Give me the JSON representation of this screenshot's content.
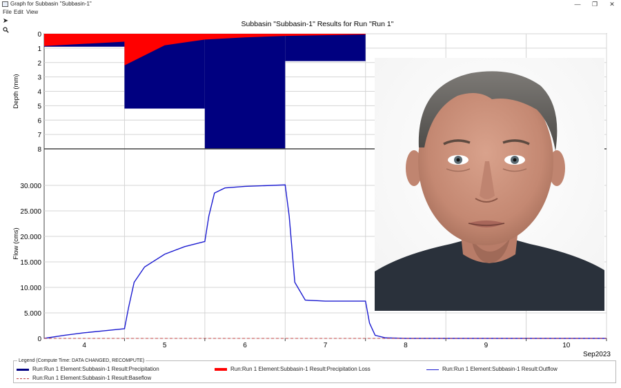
{
  "window": {
    "title": "Graph for Subbasin \"Subbasin-1\"",
    "minimize": "—",
    "restore": "❐",
    "close": "✕"
  },
  "menu": [
    "File",
    "Edit",
    "View"
  ],
  "toolbar": {
    "pointer_icon": "arrow-pointer-icon",
    "zoom_icon": "magnifier-icon"
  },
  "colors": {
    "precipitation": "#000080",
    "precip_loss": "#ff0000",
    "outflow": "#1a1ad0",
    "baseflow": "#c04040",
    "grid": "#d4d4d4"
  },
  "chart_data": [
    {
      "type": "bar",
      "orientation": "inverted",
      "ylabel": "Depth (mm)",
      "yticks": [
        "0",
        "1",
        "2",
        "3",
        "4",
        "5",
        "6",
        "7",
        "8"
      ],
      "ylim": [
        0,
        8
      ],
      "x_days": [
        "4",
        "5",
        "6",
        "7",
        "8",
        "9",
        "10"
      ],
      "precipitation_blocks": [
        {
          "from_day": 3.5,
          "to_day": 4.5,
          "depth": 0.9
        },
        {
          "from_day": 4.5,
          "to_day": 5.5,
          "depth": 5.2
        },
        {
          "from_day": 5.5,
          "to_day": 6.5,
          "depth": 8.0
        },
        {
          "from_day": 6.5,
          "to_day": 7.5,
          "depth": 1.9
        }
      ],
      "precipitation_loss": [
        {
          "day": 3.5,
          "depth": 0.85
        },
        {
          "day": 4.5,
          "depth": 0.55
        },
        {
          "day": 4.5,
          "depth": 2.2
        },
        {
          "day": 5.0,
          "depth": 0.8
        },
        {
          "day": 5.5,
          "depth": 0.4
        },
        {
          "day": 6.0,
          "depth": 0.25
        },
        {
          "day": 6.5,
          "depth": 0.15
        },
        {
          "day": 7.5,
          "depth": 0.05
        }
      ]
    },
    {
      "type": "line",
      "ylabel": "Flow (cms)",
      "yticks": [
        "0",
        "5.000",
        "10.000",
        "15.000",
        "20.000",
        "25.000",
        "30.000"
      ],
      "ylim": [
        0,
        35
      ],
      "xlabel": "Sep2023",
      "x_days": [
        "4",
        "5",
        "6",
        "7",
        "8",
        "9",
        "10"
      ],
      "series": [
        {
          "name": "Run:Run 1 Element:Subbasin-1 Result:Outflow",
          "points": [
            [
              3.5,
              0.0
            ],
            [
              3.75,
              0.6
            ],
            [
              4.0,
              1.1
            ],
            [
              4.25,
              1.5
            ],
            [
              4.5,
              1.9
            ],
            [
              4.55,
              6.0
            ],
            [
              4.62,
              11.0
            ],
            [
              4.75,
              14.0
            ],
            [
              5.0,
              16.5
            ],
            [
              5.25,
              18.0
            ],
            [
              5.5,
              19.0
            ],
            [
              5.55,
              24.0
            ],
            [
              5.62,
              28.5
            ],
            [
              5.75,
              29.5
            ],
            [
              6.0,
              29.8
            ],
            [
              6.5,
              30.1
            ],
            [
              6.55,
              24.0
            ],
            [
              6.62,
              11.0
            ],
            [
              6.75,
              7.5
            ],
            [
              7.0,
              7.3
            ],
            [
              7.5,
              7.3
            ],
            [
              7.55,
              3.0
            ],
            [
              7.62,
              0.6
            ],
            [
              7.75,
              0.1
            ],
            [
              8.0,
              0.0
            ],
            [
              10.5,
              0.0
            ]
          ]
        },
        {
          "name": "Run:Run 1 Element:Subbasin-1 Result:Baseflow",
          "points": [
            [
              3.5,
              0.0
            ],
            [
              10.5,
              0.0
            ]
          ]
        }
      ]
    }
  ],
  "chart_title": "Subbasin \"Subbasin-1\" Results for Run \"Run 1\"",
  "legend": {
    "title": "Legend (Compute Time: DATA CHANGED, RECOMPUTE)",
    "items": [
      "Run:Run 1 Element:Subbasin-1 Result:Precipitation",
      "Run:Run 1 Element:Subbasin-1 Result:Precipitation Loss",
      "Run:Run 1 Element:Subbasin-1 Result:Outflow",
      "Run:Run 1 Element:Subbasin-1 Result:Baseflow"
    ]
  }
}
